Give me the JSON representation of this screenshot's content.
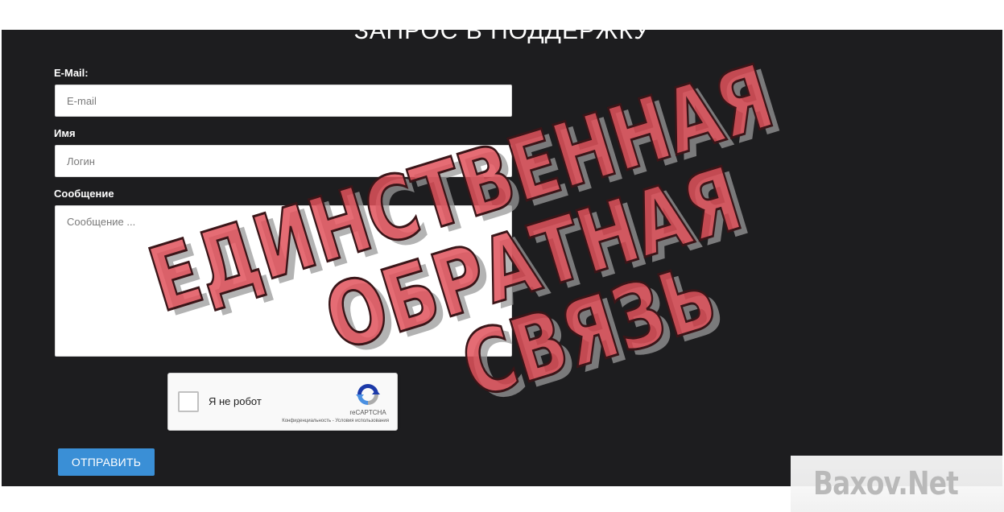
{
  "form": {
    "title": "ЗАПРОС В ПОДДЕРЖКУ",
    "email": {
      "label": "E-Mail:",
      "placeholder": "E-mail"
    },
    "name": {
      "label": "Имя",
      "placeholder": "Логин"
    },
    "message": {
      "label": "Сообщение",
      "placeholder": "Сообщение ..."
    },
    "recaptcha": {
      "checkbox_label": "Я не робот",
      "brand": "reCAPTCHA",
      "links": "Конфиденциальность - Условия использования"
    },
    "submit_label": "ОТПРАВИТЬ"
  },
  "stamp": {
    "line1": "ЕДИНСТВЕННАЯ",
    "line2": "ОБРАТНАЯ",
    "line3": "СВЯЗЬ",
    "color": "#e0525c"
  },
  "watermark": {
    "text": "Baxov.Net"
  },
  "colors": {
    "panel_bg": "#1d1d1f",
    "button": "#3a8fd6",
    "recaptcha_blue": "#1c3aa9",
    "recaptcha_light": "#4a90e2",
    "recaptcha_gray": "#ababab"
  }
}
